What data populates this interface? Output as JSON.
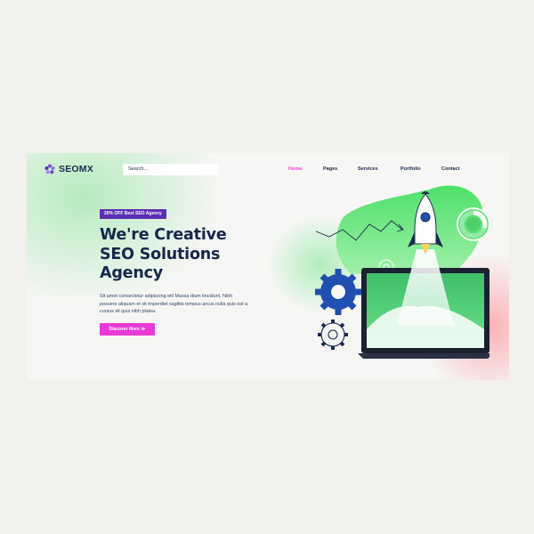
{
  "brand": {
    "name": "SEOMX"
  },
  "search": {
    "placeholder": "Search..."
  },
  "nav": {
    "items": [
      {
        "label": "Home",
        "active": true
      },
      {
        "label": "Pages",
        "active": false
      },
      {
        "label": "Services",
        "active": false
      },
      {
        "label": "Portfolio",
        "active": false
      },
      {
        "label": "Contact",
        "active": false
      }
    ]
  },
  "hero": {
    "badge": "20% OFF Best SEO Agency",
    "headline_lines": [
      "We're Creative",
      "SEO Solutions",
      "Agency"
    ],
    "description": "Sit amet consectetur adipiscing elit Massa diam tincidunt. Nibh posuere aliquam et sit imperdiet sagittis tempus arcus nulla quis est a cursus sit quis nibh platea.",
    "cta_label": "Discover More ≫"
  },
  "colors": {
    "accent_pink": "#ea3ad6",
    "badge_purple": "#5b2fb3",
    "navy": "#15284b",
    "green": "#5fe07a"
  },
  "icons": [
    "logo-icon",
    "rocket-icon",
    "gear-icon",
    "laptop-icon",
    "donut-chart-icon",
    "line-chart-icon"
  ]
}
